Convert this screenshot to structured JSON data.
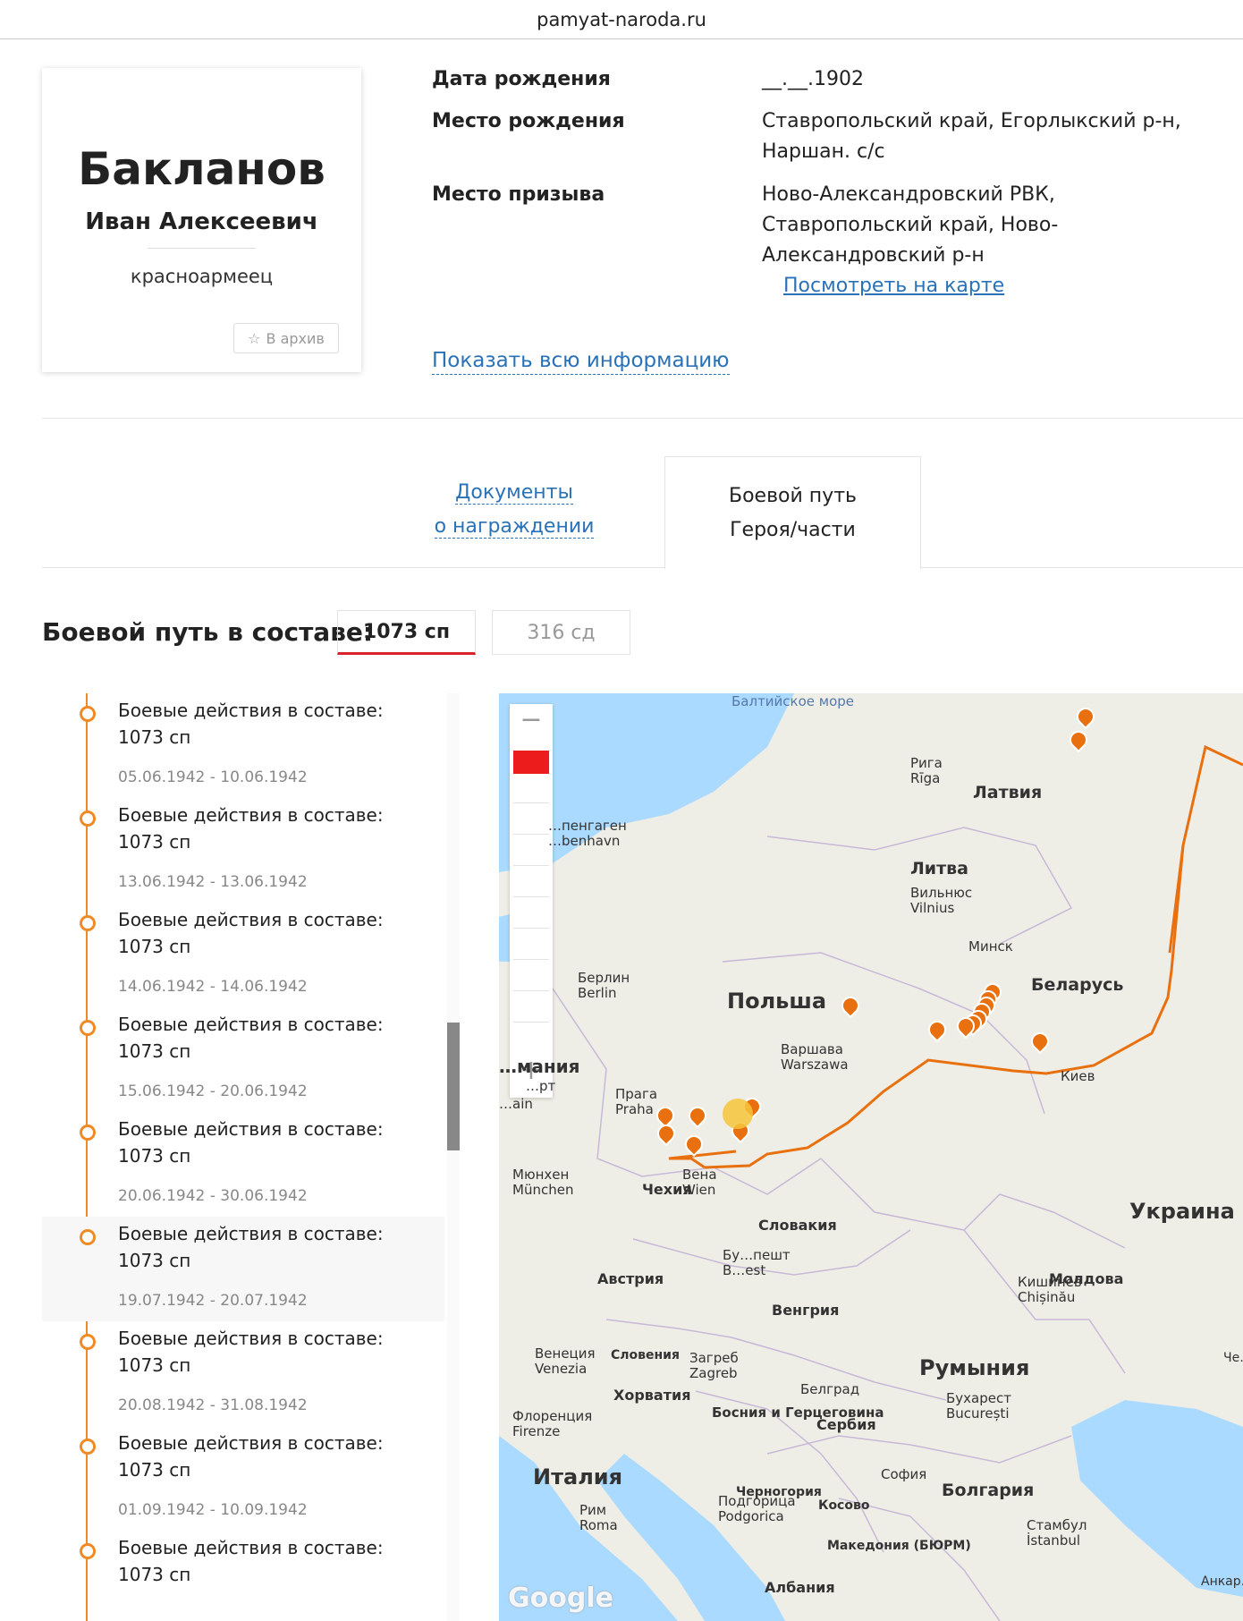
{
  "browser": {
    "url": "pamyat-naroda.ru"
  },
  "person": {
    "surname": "Бакланов",
    "given_names": "Иван Алексеевич",
    "rank": "красноармеец",
    "archive_button": "В архив"
  },
  "info": {
    "birth_date_label": "Дата рождения",
    "birth_date_value": "__.__.1902",
    "birth_place_label": "Место рождения",
    "birth_place_value": "Ставропольский край, Егорлыкский р-н, Наршан. с/с",
    "draft_place_label": "Место призыва",
    "draft_place_value": "Ново-Александровский РВК, Ставропольский край, Ново-Александровский р-н",
    "map_link": "Посмотреть на карте",
    "show_all": "Показать всю информацию"
  },
  "tabs": {
    "documents_line1": "Документы",
    "documents_line2": "о награждении",
    "path_line1": "Боевой путь",
    "path_line2": "Героя/части"
  },
  "combat_path": {
    "label": "Боевой путь в составе:",
    "units": [
      "1073 сп",
      "316 сд"
    ],
    "active_unit": "1073 сп"
  },
  "timeline": [
    {
      "title": "Боевые действия в составе: 1073 сп",
      "from": "05.06.1942",
      "to": "10.06.1942"
    },
    {
      "title": "Боевые действия в составе: 1073 сп",
      "from": "13.06.1942",
      "to": "13.06.1942"
    },
    {
      "title": "Боевые действия в составе: 1073 сп",
      "from": "14.06.1942",
      "to": "14.06.1942"
    },
    {
      "title": "Боевые действия в составе: 1073 сп",
      "from": "15.06.1942",
      "to": "20.06.1942"
    },
    {
      "title": "Боевые действия в составе: 1073 сп",
      "from": "20.06.1942",
      "to": "30.06.1942"
    },
    {
      "title": "Боевые действия в составе: 1073 сп",
      "from": "19.07.1942",
      "to": "20.07.1942"
    },
    {
      "title": "Боевые действия в составе: 1073 сп",
      "from": "20.08.1942",
      "to": "31.08.1942"
    },
    {
      "title": "Боевые действия в составе: 1073 сп",
      "from": "01.09.1942",
      "to": "10.09.1942"
    },
    {
      "title": "Боевые действия в составе: 1073 сп",
      "from": "",
      "to": ""
    }
  ],
  "map": {
    "route_color": "#e8700f",
    "attribution": "Google",
    "countries": [
      "Латвия",
      "Литва",
      "Беларусь",
      "Польша",
      "Украина",
      "Чехия",
      "Словакия",
      "Австрия",
      "Венгрия",
      "Молдова",
      "Румыния",
      "Словения",
      "Хорватия",
      "Сербия",
      "Италия",
      "Болгария",
      "Черногория",
      "Косово",
      "Македония (БЮРМ)",
      "Албания",
      "Босния и Герцеговина"
    ],
    "cities": {
      "riga": "Рига\nRīga",
      "vilnius": "Вильнюс\nVilnius",
      "minsk": "Минск",
      "berlin": "Берлин\nBerlin",
      "warsaw": "Варшава\nWarszawa",
      "kiev": "Киев",
      "prague": "Прага\nPraha",
      "vienna": "Вена\nWien",
      "munich": "Мюнхен\nMünchen",
      "chisinau": "Кишинёв\nChișinău",
      "zagreb": "Загреб\nZagreb",
      "venice": "Венеция\nVenezia",
      "florence": "Флоренция\nFirenze",
      "belgrade": "Белград",
      "bucharest": "Бухарест\nBucurești",
      "sofia": "София",
      "rome": "Рим\nRoma",
      "podgorica": "Подгорица\nPodgorica",
      "istanbul": "Стамбул\nİstanbul",
      "copenhagen": "…пенгаген\n…benhavn",
      "budapest": "Бу…пешт\nB…est"
    },
    "partial_labels": [
      "…мания",
      "Балтийское море",
      "Анкар…",
      "…рт",
      "…ain",
      "Че…"
    ]
  }
}
